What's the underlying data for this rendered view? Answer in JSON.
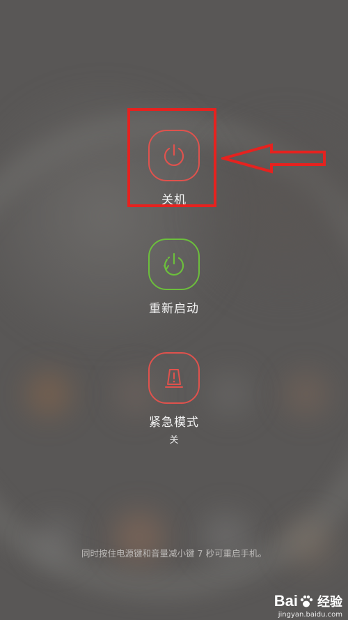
{
  "actions": {
    "power_off": {
      "label": "关机",
      "color": "#e0524d"
    },
    "restart": {
      "label": "重新启动",
      "color": "#6cbf3c"
    },
    "emergency": {
      "label": "紧急模式",
      "status": "关",
      "color": "#e0524d"
    }
  },
  "hint": "同时按住电源键和音量减小键 7 秒可重启手机。",
  "watermark": {
    "brand_left": "Bai",
    "brand_right": "经验",
    "url": "jingyan.baidu.com"
  },
  "annotation_color": "#e6221f"
}
